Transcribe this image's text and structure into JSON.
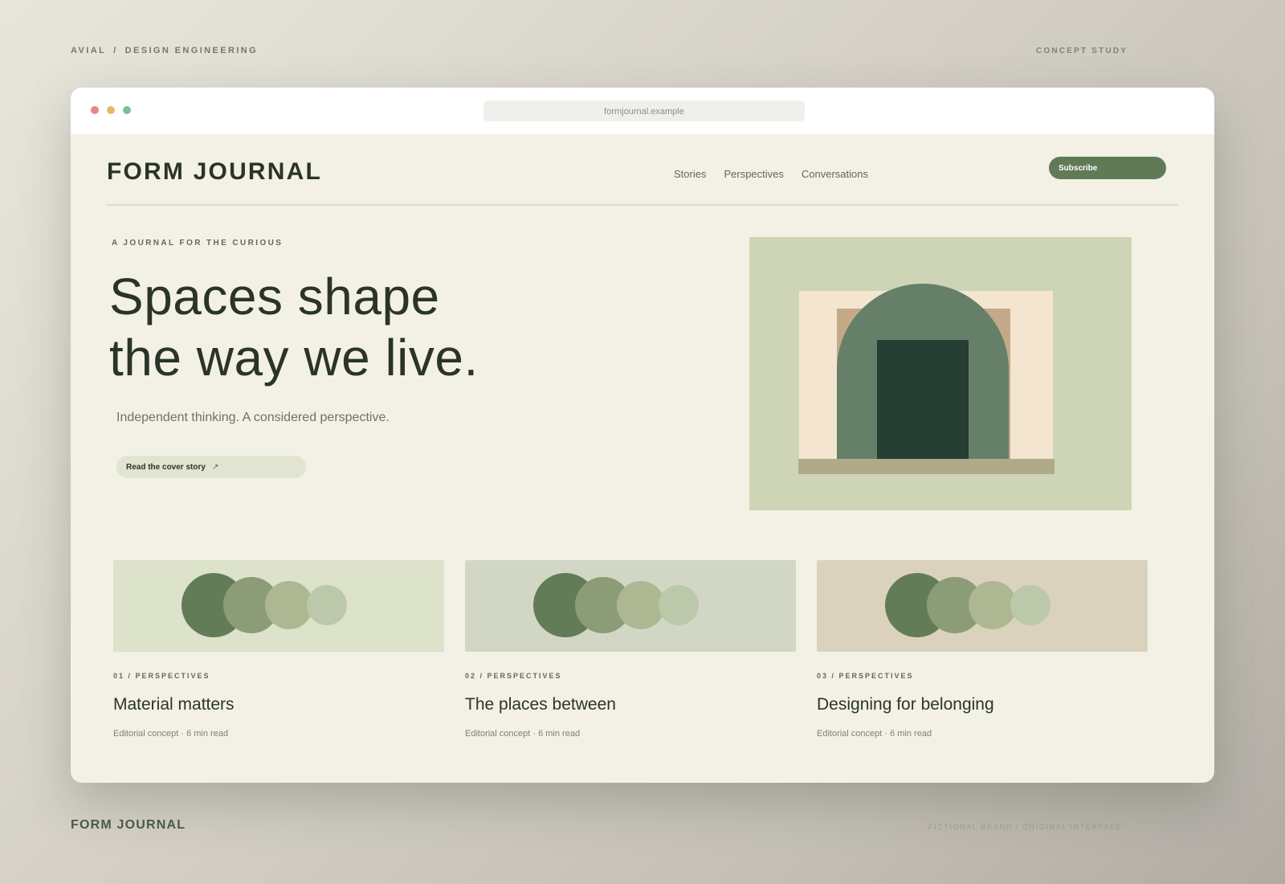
{
  "page": {
    "top_left": {
      "brand": "AVIAL",
      "separator": "/",
      "section": "DESIGN ENGINEERING"
    },
    "top_right": "CONCEPT STUDY",
    "bottom_left": "FORM JOURNAL",
    "bottom_right": "FICTIONAL BRAND / ORIGINAL INTERFACE"
  },
  "browser": {
    "url": "formjournal.example"
  },
  "header": {
    "logo": "FORM JOURNAL",
    "nav": [
      "Stories",
      "Perspectives",
      "Conversations"
    ],
    "subscribe_label": "Subscribe"
  },
  "hero": {
    "eyebrow": "A JOURNAL FOR THE CURIOUS",
    "headline_line1": "Spaces shape",
    "headline_line2": "the way we live.",
    "subhead": "Independent thinking. A considered perspective.",
    "cta_label": "Read the cover story",
    "cta_icon": "↗"
  },
  "cards": [
    {
      "tag": "01 / PERSPECTIVES",
      "title": "Material matters",
      "meta": "Editorial concept · 6 min read",
      "bg": "#dde2cb"
    },
    {
      "tag": "02 / PERSPECTIVES",
      "title": "The places between",
      "meta": "Editorial concept · 6 min read",
      "bg": "#d2d7c5"
    },
    {
      "tag": "03 / PERSPECTIVES",
      "title": "Designing for belonging",
      "meta": "Editorial concept · 6 min read",
      "bg": "#dad2bc"
    }
  ],
  "colors": {
    "accent": "#607a58",
    "ink": "#2a3428",
    "paper": "#f3f1e6"
  }
}
